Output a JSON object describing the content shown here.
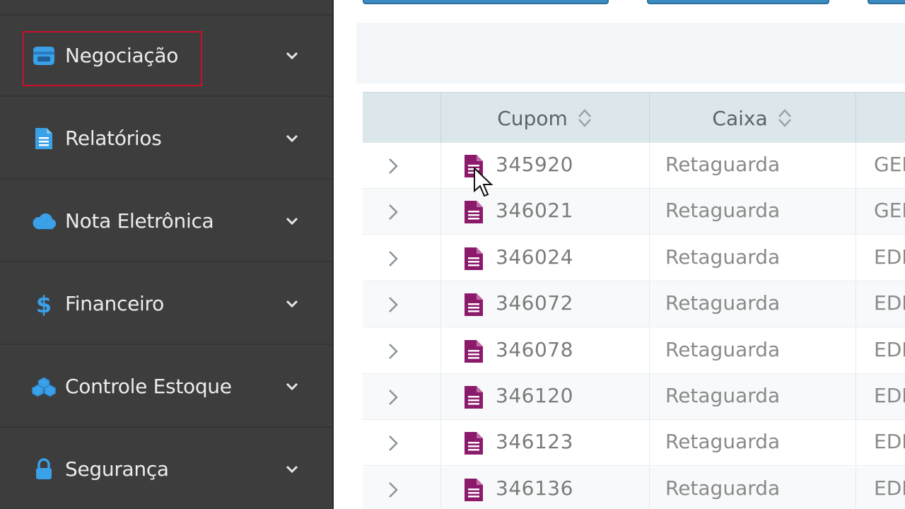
{
  "sidebar": {
    "items": [
      {
        "label": "Negociação",
        "icon": "store-icon",
        "color": "#3aa0e8"
      },
      {
        "label": "Relatórios",
        "icon": "document-icon",
        "color": "#3aa0e8"
      },
      {
        "label": "Nota Eletrônica",
        "icon": "cloud-icon",
        "color": "#3aa0e8"
      },
      {
        "label": "Financeiro",
        "icon": "dollar-icon",
        "color": "#3aa0e8"
      },
      {
        "label": "Controle Estoque",
        "icon": "cubes-icon",
        "color": "#3aa0e8"
      },
      {
        "label": "Segurança",
        "icon": "lock-icon",
        "color": "#3aa0e8"
      }
    ],
    "highlight_color": "#c8102e"
  },
  "table": {
    "columns": [
      "Cupom",
      "Caixa"
    ],
    "rows": [
      {
        "cupom": "345920",
        "caixa": "Retaguarda",
        "extra": "GEI"
      },
      {
        "cupom": "346021",
        "caixa": "Retaguarda",
        "extra": "GEI"
      },
      {
        "cupom": "346024",
        "caixa": "Retaguarda",
        "extra": "EDI"
      },
      {
        "cupom": "346072",
        "caixa": "Retaguarda",
        "extra": "EDI"
      },
      {
        "cupom": "346078",
        "caixa": "Retaguarda",
        "extra": "EDI"
      },
      {
        "cupom": "346120",
        "caixa": "Retaguarda",
        "extra": "EDI"
      },
      {
        "cupom": "346123",
        "caixa": "Retaguarda",
        "extra": "EDI"
      },
      {
        "cupom": "346136",
        "caixa": "Retaguarda",
        "extra": "EDI"
      }
    ],
    "doc_icon_color": "#8b1a6b"
  }
}
